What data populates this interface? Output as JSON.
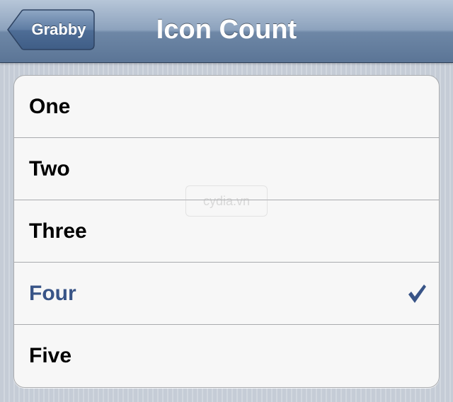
{
  "navbar": {
    "back_label": "Grabby",
    "title": "Icon Count"
  },
  "options": {
    "items": [
      {
        "label": "One",
        "selected": false
      },
      {
        "label": "Two",
        "selected": false
      },
      {
        "label": "Three",
        "selected": false
      },
      {
        "label": "Four",
        "selected": true
      },
      {
        "label": "Five",
        "selected": false
      }
    ]
  },
  "watermark": {
    "text": "cydia.vn"
  },
  "icons": {
    "back": "chevron-left-icon",
    "selected": "checkmark-icon"
  },
  "colors": {
    "navbar": "#6e87a6",
    "selected_text": "#385487",
    "checkmark": "#385487",
    "cell_background": "#f7f7f7",
    "page_background": "#cbd2db"
  }
}
